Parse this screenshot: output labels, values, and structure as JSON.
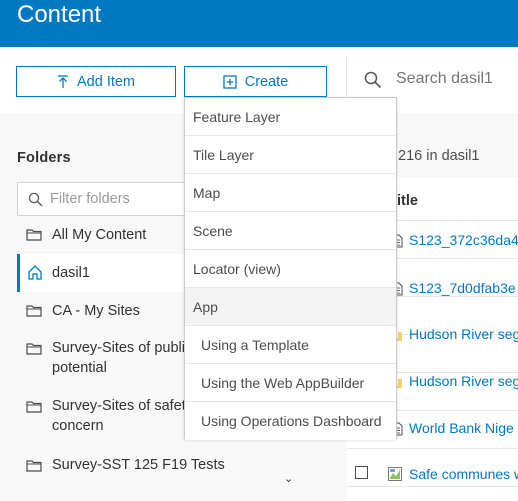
{
  "header": {
    "title": "Content"
  },
  "toolbar": {
    "add_item_label": "Add Item",
    "create_label": "Create",
    "search_placeholder": "Search dasil1"
  },
  "folders": {
    "title": "Folders",
    "filter_placeholder": "Filter folders",
    "items": [
      {
        "label_line1": "All My Content",
        "label_line2": "",
        "icon": "folder-icon"
      },
      {
        "label_line1": "dasil1",
        "label_line2": "",
        "icon": "home-icon",
        "selected": true
      },
      {
        "label_line1": "CA - My Sites",
        "label_line2": "",
        "icon": "folder-icon"
      },
      {
        "label_line1": "Survey-Sites of public",
        "label_line2": "potential",
        "icon": "folder-icon"
      },
      {
        "label_line1": "Survey-Sites of safety",
        "label_line2": "concern",
        "icon": "folder-icon"
      },
      {
        "label_line1": "Survey-SST 125 F19 Tests",
        "label_line2": "",
        "icon": "folder-icon"
      }
    ]
  },
  "content": {
    "count_text": "f 216 in dasil1",
    "column_title": "itle",
    "rows": [
      {
        "title": "S123_372c36da4",
        "icon": "document-icon"
      },
      {
        "title": "S123_7d0dfab3e",
        "icon": "document-icon"
      },
      {
        "title": "Hudson River seg",
        "icon": "layer-icon"
      },
      {
        "title": "Hudson River seg",
        "icon": "layer-icon"
      },
      {
        "title": "World Bank Nige",
        "icon": "document-icon"
      },
      {
        "title": "Safe communes w",
        "icon": "map-icon"
      }
    ]
  },
  "create_menu": {
    "items": [
      {
        "label": "Feature Layer"
      },
      {
        "label": "Tile Layer"
      },
      {
        "label": "Map"
      },
      {
        "label": "Scene"
      },
      {
        "label": "Locator (view)"
      },
      {
        "label": "App"
      },
      {
        "label": "Using a Template"
      },
      {
        "label": "Using the Web AppBuilder"
      },
      {
        "label": "Using Operations Dashboard"
      }
    ]
  },
  "colors": {
    "brand": "#0079c1",
    "panel": "#f8f8f8",
    "layer_icon": "#e8b830"
  }
}
